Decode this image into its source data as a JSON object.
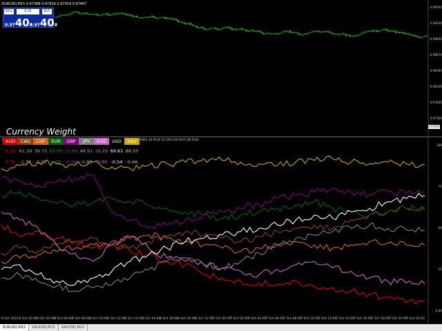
{
  "symbol_info": "EURUSD,M15  0.97388 0.97416 0.97354 0.97407",
  "trade_panel": {
    "sell_label": "SELL",
    "buy_label": "BUY",
    "lot": "0.10",
    "sell_small": "0.97",
    "sell_big": "40",
    "sell_sup": "7",
    "buy_small": "0.97",
    "buy_big": "40",
    "buy_sup": "8"
  },
  "price_axis": {
    "labels": [
      "0.99505",
      "0.99220",
      "0.98945",
      "0.98670",
      "0.98395",
      "0.98120",
      "0.97845",
      "0.97560"
    ],
    "current_tag": "0.97407"
  },
  "indicator": {
    "header": "Ddown: WEAKENED, Up=STRENGTHENED M15=48B bars 6.1923 61.3868 39.7178 63.0490 71.8962 48.9130 16.2923 69.6075 88.5042",
    "title": "Currency Weight",
    "currencies": [
      {
        "code": "AUD",
        "color": "#dd0000",
        "text": "#ffffff"
      },
      {
        "code": "CAD",
        "color": "#8b4513",
        "text": "#ffffff"
      },
      {
        "code": "CHF",
        "color": "#d2691e",
        "text": "#ffffff"
      },
      {
        "code": "EUR",
        "color": "#006400",
        "text": "#ffffff"
      },
      {
        "code": "GBP",
        "color": "#800080",
        "text": "#ffffff"
      },
      {
        "code": "JPY",
        "color": "#808080",
        "text": "#ffffff"
      },
      {
        "code": "NZD",
        "color": "#cc66cc",
        "text": "#ffffff"
      },
      {
        "code": "USD",
        "color": "#000000",
        "text": "#ffffff"
      },
      {
        "code": "XAU",
        "color": "#ccaa00",
        "text": "#ffffff"
      }
    ],
    "values": [
      "6.19",
      "61.39",
      "39.72",
      "63.05",
      "71.89",
      "48.91",
      "16.29",
      "69.61",
      "88.50"
    ],
    "changes": [
      "0.05",
      "-1.57",
      "-2.01",
      "0.09",
      "-0.06",
      "-0.83",
      "-0.80",
      "-0.54",
      "-0.66"
    ],
    "value_colors": [
      "#dd0000",
      "#d2a06e",
      "#d2a06e",
      "#2e8b2e",
      "#993399",
      "#aaaaaa",
      "#cc66cc",
      "#ffffff",
      "#e0c040"
    ],
    "y_labels": [
      "100",
      "75",
      "50",
      "25",
      "0.00"
    ]
  },
  "time_labels": [
    "6 Oct 2022",
    "6 Oct 02:00",
    "6 Oct 04:00",
    "6 Oct 06:00",
    "6 Oct 08:00",
    "6 Oct 10:00",
    "6 Oct 12:00",
    "6 Oct 14:00",
    "6 Oct 16:00",
    "6 Oct 18:00",
    "6 Oct 20:00",
    "6 Oct 22:00",
    "7 Oct 00:00",
    "7 Oct 02:00",
    "7 Oct 04:00",
    "7 Oct 06:00",
    "7 Oct 08:00",
    "7 Oct 10:00",
    "7 Oct 12:00",
    "7 Oct 14:00",
    "7 Oct 16:00",
    "7 Oct 18:00",
    "7 Oct 20:00",
    "7 Oct 22:00"
  ],
  "tabs": [
    "EURUSD,M15",
    "XAUUSD,M15",
    "XAUUSD,M15"
  ],
  "chart_data": {
    "type": "line",
    "title": "Currency Weight",
    "ylim": [
      0,
      100
    ],
    "series": [
      {
        "name": "AUD",
        "color": "#dd0000",
        "values": [
          52,
          45,
          48,
          44,
          42,
          38,
          40,
          36,
          34,
          30,
          28,
          22,
          20,
          18,
          17,
          16,
          18,
          15,
          14,
          12,
          10,
          8,
          5,
          6.19
        ]
      },
      {
        "name": "CAD",
        "color": "#8b4513",
        "values": [
          35,
          38,
          36,
          40,
          42,
          44,
          40,
          38,
          42,
          45,
          48,
          46,
          44,
          42,
          45,
          48,
          50,
          52,
          50,
          55,
          58,
          60,
          62,
          61.39
        ]
      },
      {
        "name": "CHF",
        "color": "#d2691e",
        "values": [
          30,
          32,
          34,
          36,
          38,
          40,
          42,
          44,
          46,
          44,
          42,
          40,
          38,
          36,
          38,
          40,
          42,
          40,
          38,
          40,
          42,
          41,
          40,
          39.72
        ]
      },
      {
        "name": "EUR",
        "color": "#006400",
        "values": [
          70,
          72,
          68,
          65,
          64,
          66,
          68,
          66,
          64,
          62,
          60,
          58,
          56,
          58,
          60,
          62,
          64,
          66,
          62,
          60,
          58,
          60,
          62,
          63.05
        ]
      },
      {
        "name": "GBP",
        "color": "#800080",
        "values": [
          80,
          78,
          76,
          78,
          80,
          82,
          60,
          55,
          50,
          52,
          55,
          58,
          60,
          62,
          64,
          68,
          70,
          72,
          74,
          72,
          70,
          72,
          71,
          71.89
        ]
      },
      {
        "name": "JPY",
        "color": "#808080",
        "values": [
          20,
          22,
          18,
          15,
          12,
          14,
          16,
          20,
          25,
          30,
          32,
          28,
          26,
          30,
          35,
          40,
          44,
          46,
          48,
          50,
          52,
          50,
          49,
          48.91
        ]
      },
      {
        "name": "NZD",
        "color": "#cc66cc",
        "values": [
          60,
          55,
          50,
          40,
          35,
          30,
          40,
          45,
          38,
          32,
          30,
          28,
          26,
          24,
          22,
          25,
          28,
          30,
          26,
          24,
          20,
          18,
          17,
          16.29
        ]
      },
      {
        "name": "USD",
        "color": "#ffffff",
        "values": [
          25,
          28,
          22,
          18,
          16,
          20,
          24,
          30,
          34,
          38,
          42,
          44,
          46,
          48,
          50,
          52,
          55,
          58,
          56,
          60,
          62,
          66,
          68,
          69.61
        ]
      },
      {
        "name": "XAU",
        "color": "#ccaa00",
        "values": [
          86,
          88,
          90,
          89,
          88,
          90,
          87,
          86,
          88,
          89,
          90,
          92,
          91,
          90,
          89,
          88,
          90,
          91,
          92,
          90,
          89,
          90,
          89,
          88.5
        ]
      }
    ]
  }
}
